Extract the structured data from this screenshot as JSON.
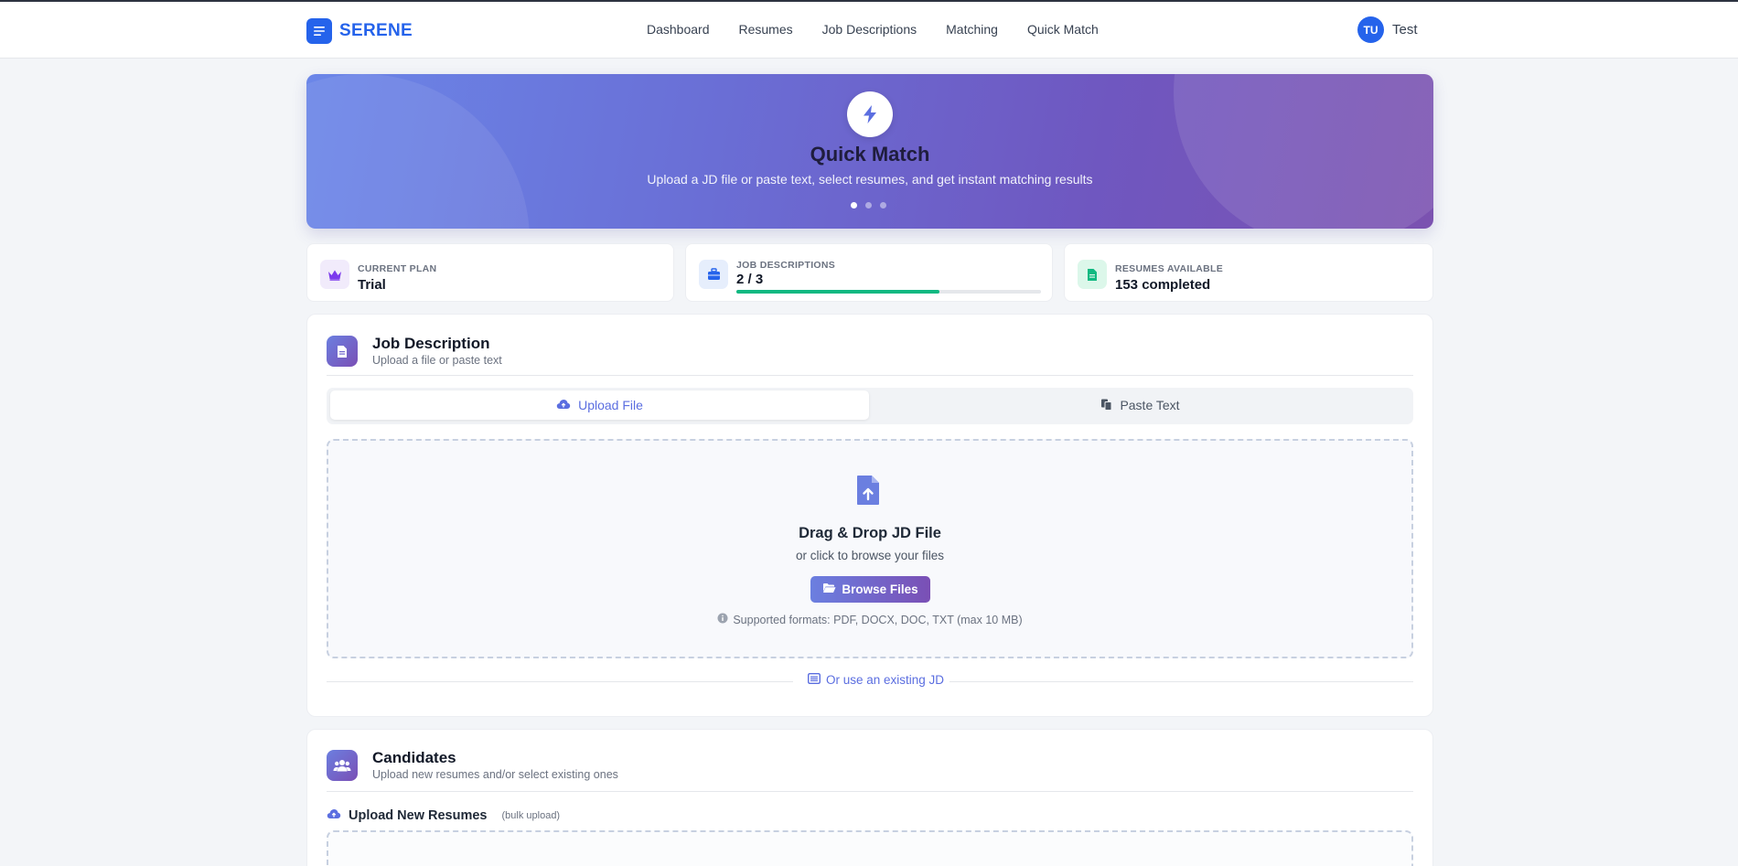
{
  "app": {
    "brand": "SERENE",
    "nav": [
      "Dashboard",
      "Resumes",
      "Job Descriptions",
      "Matching",
      "Quick Match"
    ],
    "user": {
      "initials": "TU",
      "name": "Test"
    }
  },
  "hero": {
    "title": "Quick Match",
    "subtitle": "Upload a JD file or paste text, select resumes, and get instant matching results",
    "slides": 3,
    "active_slide": 0
  },
  "stats": {
    "plan": {
      "label": "CURRENT PLAN",
      "value": "Trial"
    },
    "jds": {
      "label": "JOB DESCRIPTIONS",
      "value": "2 / 3",
      "progress_fraction": 0.667
    },
    "resumes": {
      "label": "RESUMES AVAILABLE",
      "value": "153 completed"
    }
  },
  "job_description": {
    "title": "Job Description",
    "subtitle": "Upload a file or paste text",
    "tabs": {
      "upload": "Upload File",
      "paste": "Paste Text"
    },
    "dropzone": {
      "title": "Drag & Drop JD File",
      "subtitle": "or click to browse your files",
      "button": "Browse Files",
      "formats": "Supported formats: PDF, DOCX, DOC, TXT (max 10 MB)"
    },
    "existing_link": "Or use an existing JD"
  },
  "candidates": {
    "title": "Candidates",
    "subtitle": "Upload new resumes and/or select existing ones",
    "upload_heading": "Upload New Resumes",
    "upload_note": "(bulk upload)"
  },
  "colors": {
    "brand": "#2563eb",
    "accent": "#5b6ee0",
    "progress": "#10b981"
  }
}
